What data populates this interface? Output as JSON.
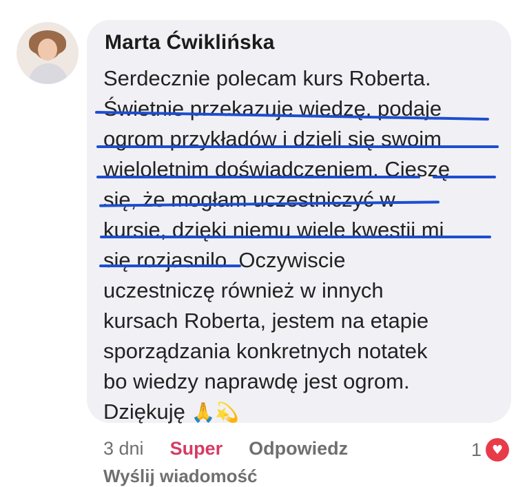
{
  "author": {
    "name": "Marta Ćwiklińska"
  },
  "comment": {
    "lines": [
      "Serdecznie polecam kurs Roberta.",
      "Świetnie przekazuje wiedzę, podaje",
      "ogrom przykładów i dzieli się swoim",
      "wieloletnim doświadczeniem. Cieszę",
      "się, że mogłam uczestniczyć w",
      "kursie, dzięki niemu wiele kwestii mi",
      "się rozjasnilo. Oczywiscie",
      "uczestniczę również w innych",
      "kursach Roberta, jestem na etapie",
      "sporządzania konkretnych notatek",
      "bo wiedzy naprawdę jest ogrom.",
      "Dziękuję"
    ],
    "emojis": "🙏💫"
  },
  "actions": {
    "time": "3 dni",
    "reaction": "Super",
    "reply": "Odpowiedz",
    "send_message": "Wyślij wiadomość"
  },
  "reactions": {
    "count": "1",
    "icon": "heart-icon"
  },
  "colors": {
    "bubble": "#f0f0f5",
    "highlight": "#1d4ecf",
    "super": "#d63b64",
    "heart": "#e83b4a"
  }
}
